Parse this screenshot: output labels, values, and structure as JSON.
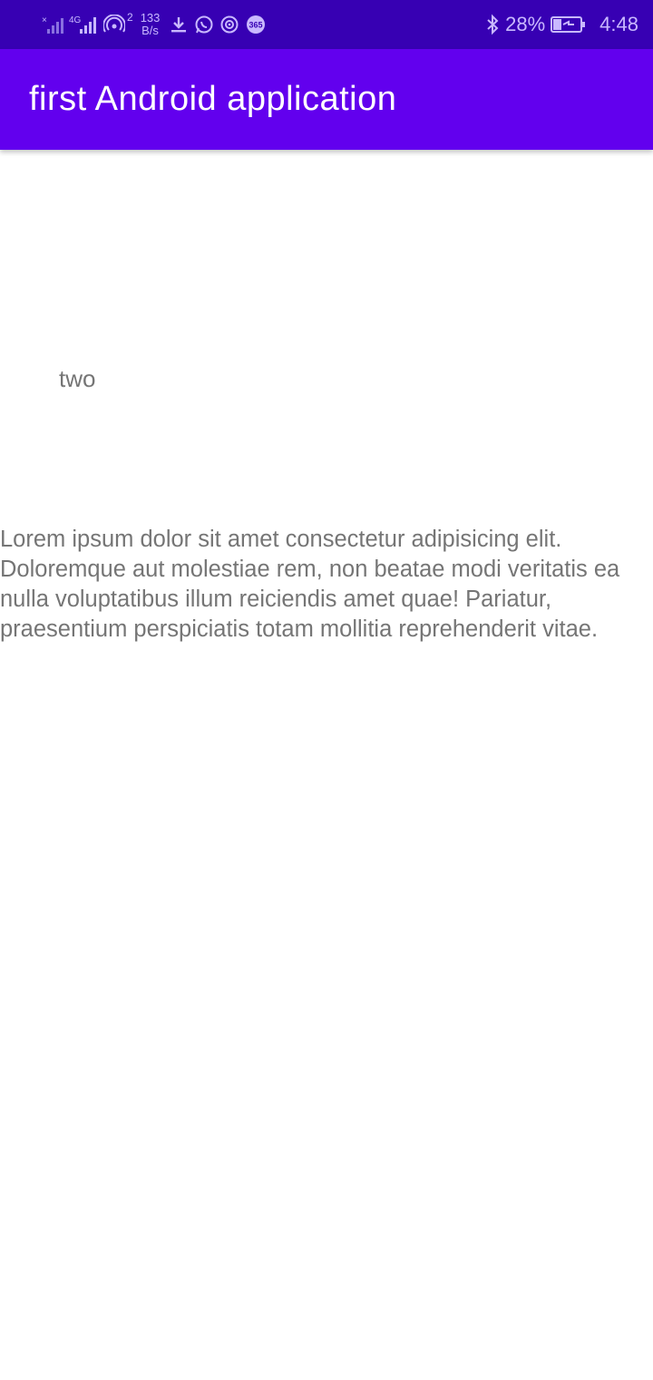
{
  "status_bar": {
    "speed_value": "133",
    "speed_unit": "B/s",
    "hotspot_count": "2",
    "battery": "28%",
    "time": "4:48",
    "icons": [
      "signal-x-icon",
      "signal-4g-icon",
      "hotspot-icon",
      "download-icon",
      "whatsapp-icon",
      "cast-icon",
      "badge-365-icon",
      "bluetooth-icon",
      "battery-charging-icon"
    ],
    "color": "#3700B3"
  },
  "app_bar": {
    "title": "first Android application",
    "color": "#6200EE"
  },
  "content": {
    "label": "two",
    "paragraph": "Lorem ipsum dolor sit amet consectetur adipisicing elit. Doloremque aut molestiae rem, non beatae modi veritatis ea nulla voluptatibus illum reiciendis amet quae! Pariatur, praesentium perspiciatis totam mollitia reprehenderit vitae.",
    "text_color": "#757575"
  }
}
